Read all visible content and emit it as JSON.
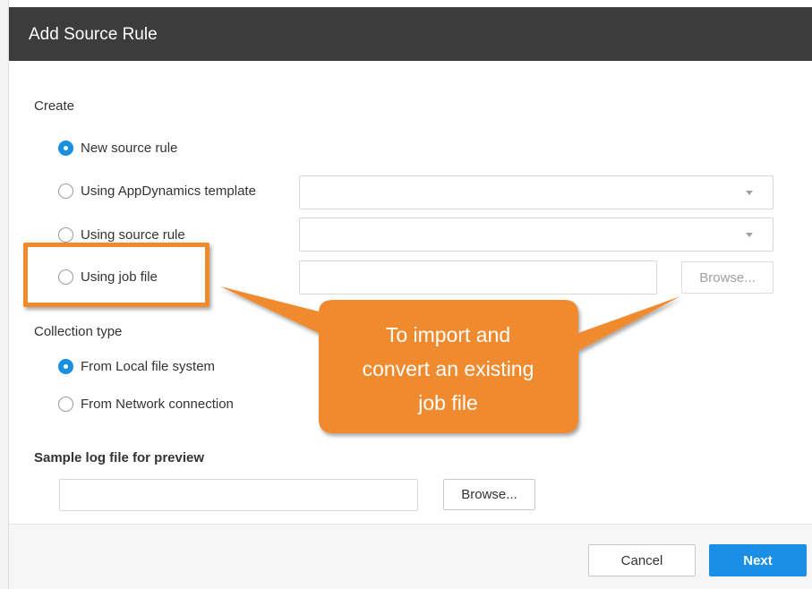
{
  "dialog": {
    "title": "Add Source Rule"
  },
  "create": {
    "label": "Create",
    "options": [
      {
        "label": "New source rule",
        "checked": true
      },
      {
        "label": "Using AppDynamics template",
        "checked": false
      },
      {
        "label": "Using source rule",
        "checked": false
      },
      {
        "label": "Using job file",
        "checked": false
      }
    ],
    "template_select_value": "",
    "source_rule_select_value": "",
    "job_file_value": "",
    "browse_label": "Browse..."
  },
  "collection": {
    "label": "Collection type",
    "options": [
      {
        "label": "From Local file system",
        "checked": true
      },
      {
        "label": "From Network connection",
        "checked": false
      }
    ]
  },
  "sample": {
    "label": "Sample log file for preview",
    "file_value": "",
    "browse_label": "Browse..."
  },
  "footer": {
    "cancel_label": "Cancel",
    "next_label": "Next"
  },
  "annotation": {
    "callout_text_line1": "To import and",
    "callout_text_line2": "convert an existing",
    "callout_text_line3": "job file",
    "accent_color": "#f08a2e"
  },
  "colors": {
    "titlebar": "#3c3c3c",
    "primary": "#1b8fe8",
    "radio_checked": "#1a8ee0"
  }
}
